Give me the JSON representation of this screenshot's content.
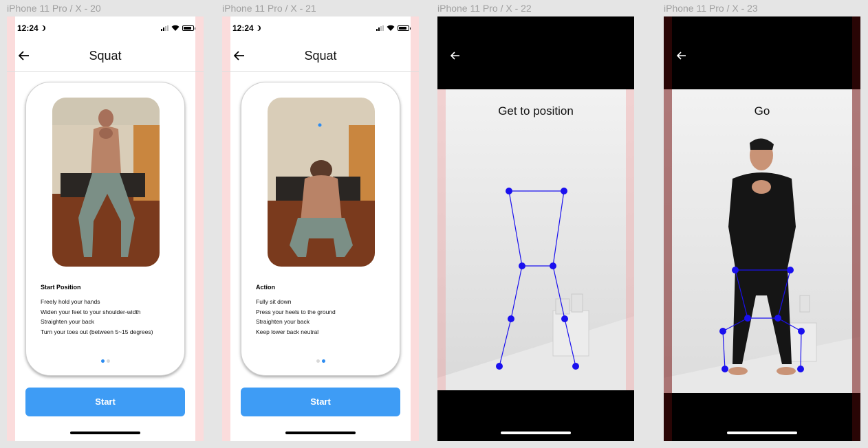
{
  "frames": [
    {
      "label": "iPhone 11 Pro / X - 20",
      "status_time": "12:24",
      "title": "Squat",
      "section_heading": "Start Position",
      "instructions": [
        "Freely hold your hands",
        "Widen your feet to your shoulder-width",
        "Straighten your back",
        "Turn your toes out (between 5~15 degrees)"
      ],
      "page_index": 0,
      "button_label": "Start"
    },
    {
      "label": "iPhone 11 Pro / X - 21",
      "status_time": "12:24",
      "title": "Squat",
      "section_heading": "Action",
      "instructions": [
        "Fully sit down",
        "Press your heels to the ground",
        "Straighten your back",
        "Keep lower back neutral"
      ],
      "page_index": 1,
      "button_label": "Start"
    },
    {
      "label": "iPhone 11 Pro / X - 22",
      "camera_text": "Get to position"
    },
    {
      "label": "iPhone 11 Pro / X - 23",
      "camera_text": "Go"
    }
  ],
  "colors": {
    "accent": "#3e9cf5",
    "dot_active": "#2d8cf0",
    "skeleton": "#1a10ee",
    "guide_pink": "#fbdcdc"
  },
  "icons": {
    "back": "arrow-left-icon",
    "signal": "signal-icon",
    "wifi": "wifi-icon",
    "battery": "battery-icon",
    "moon": "moon-icon"
  }
}
